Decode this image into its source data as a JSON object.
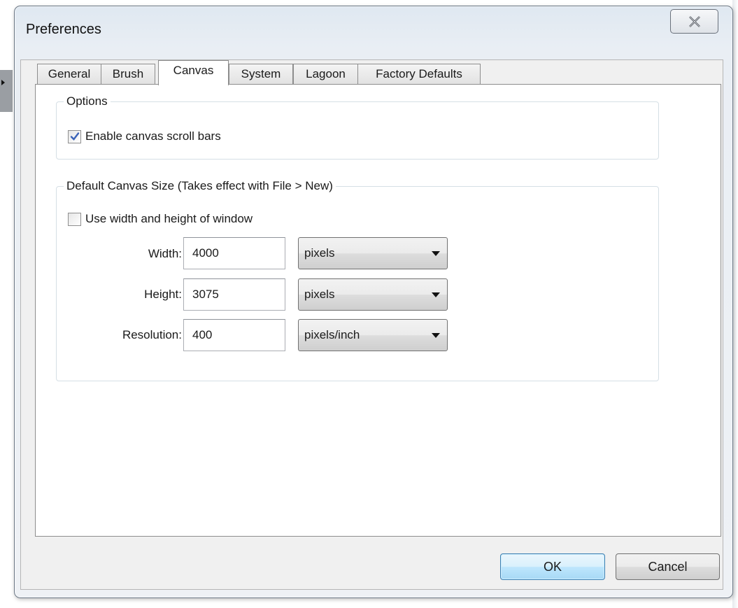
{
  "window": {
    "title": "Preferences"
  },
  "tabs": [
    {
      "label": "General",
      "active": false
    },
    {
      "label": "Brush",
      "active": false
    },
    {
      "label": "Canvas",
      "active": true
    },
    {
      "label": "System",
      "active": false
    },
    {
      "label": "Lagoon",
      "active": false
    },
    {
      "label": "Factory Defaults",
      "active": false
    }
  ],
  "options_group": {
    "legend": "Options",
    "scrollbars_checkbox": {
      "label": "Enable canvas scroll bars",
      "checked": true
    }
  },
  "canvas_size_group": {
    "legend": "Default Canvas Size (Takes effect with File > New)",
    "window_size_checkbox": {
      "label": "Use width and height of window",
      "checked": false
    },
    "fields": {
      "width": {
        "label": "Width:",
        "value": "4000",
        "unit": "pixels"
      },
      "height": {
        "label": "Height:",
        "value": "3075",
        "unit": "pixels"
      },
      "resolution": {
        "label": "Resolution:",
        "value": "400",
        "unit": "pixels/inch"
      }
    }
  },
  "buttons": {
    "ok": "OK",
    "cancel": "Cancel"
  },
  "icons": {
    "close": "close-icon",
    "checkmark": "checkmark-icon",
    "dropdown": "chevron-down-icon"
  },
  "colors": {
    "check": "#3b63b8",
    "default_button": "#3c7fb1"
  }
}
